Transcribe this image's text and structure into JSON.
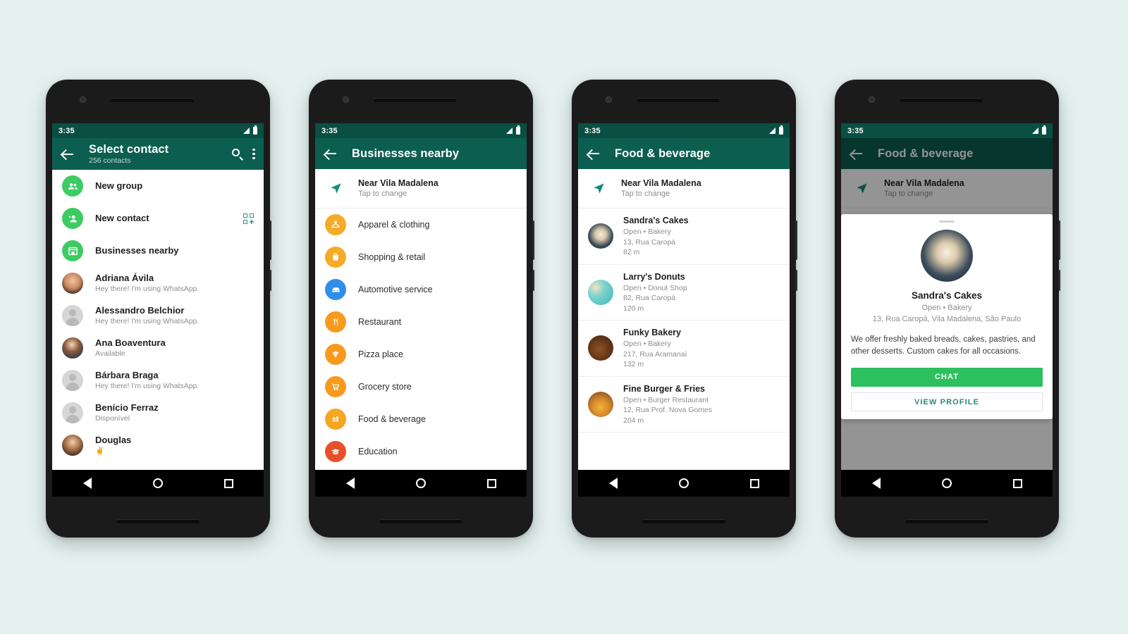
{
  "colors": {
    "page_background": "#e4f1ef",
    "appbar_teal": "#0c5e50",
    "statusbar_teal": "#0a4f43",
    "accent_green": "#3dcb64",
    "chat_button_green": "#2cc15e",
    "link_teal": "#2a8a78"
  },
  "phones": [
    {
      "status": {
        "time": "3:35",
        "signal_icon": "signal-triangle-icon",
        "battery_icon": "battery-icon"
      },
      "appbar": {
        "back_icon": "back-arrow-icon",
        "title": "Select contact",
        "subtitle": "256 contacts",
        "search_icon": "search-icon",
        "more_icon": "overflow-menu-icon"
      },
      "actions": [
        {
          "label": "New group",
          "icon": "new-group-icon",
          "icon_color": "#3dcb64"
        },
        {
          "label": "New contact",
          "icon": "new-contact-icon",
          "icon_color": "#3dcb64",
          "trailing_icon": "qr-code-icon"
        },
        {
          "label": "Businesses nearby",
          "icon": "storefront-icon",
          "icon_color": "#3dcb64"
        }
      ],
      "contacts": [
        {
          "name": "Adriana Ávila",
          "status": "Hey there! I'm using WhatsApp.",
          "avatar": "photo"
        },
        {
          "name": "Alessandro Belchior",
          "status": "Hey there! I'm using WhatsApp.",
          "avatar": "placeholder"
        },
        {
          "name": "Ana Boaventura",
          "status": "Available",
          "avatar": "photo"
        },
        {
          "name": "Bárbara Braga",
          "status": "Hey there! I'm using WhatsApp.",
          "avatar": "placeholder"
        },
        {
          "name": "Benício Ferraz",
          "status": "Disponível",
          "avatar": "placeholder"
        },
        {
          "name": "Douglas",
          "status": "✌️",
          "avatar": "photo"
        }
      ]
    },
    {
      "status": {
        "time": "3:35",
        "signal_icon": "signal-triangle-icon",
        "battery_icon": "battery-icon"
      },
      "appbar": {
        "back_icon": "back-arrow-icon",
        "title": "Businesses nearby"
      },
      "location": {
        "icon": "navigation-arrow-icon",
        "title": "Near Vila Madalena",
        "subtitle": "Tap to change"
      },
      "categories": [
        {
          "label": "Apparel & clothing",
          "icon": "hanger-icon",
          "color": "#f5ab28"
        },
        {
          "label": "Shopping & retail",
          "icon": "shopping-bag-icon",
          "color": "#f5ab28"
        },
        {
          "label": "Automotive service",
          "icon": "car-icon",
          "color": "#2f8eea"
        },
        {
          "label": "Restaurant",
          "icon": "cutlery-icon",
          "color": "#f79a1e"
        },
        {
          "label": "Pizza place",
          "icon": "pizza-slice-icon",
          "color": "#f79a1e"
        },
        {
          "label": "Grocery store",
          "icon": "shopping-cart-icon",
          "color": "#f79a1e"
        },
        {
          "label": "Food & beverage",
          "icon": "burger-drink-icon",
          "color": "#f5a623"
        },
        {
          "label": "Education",
          "icon": "graduation-cap-icon",
          "color": "#e8502a"
        }
      ]
    },
    {
      "status": {
        "time": "3:35",
        "signal_icon": "signal-triangle-icon",
        "battery_icon": "battery-icon"
      },
      "appbar": {
        "back_icon": "back-arrow-icon",
        "title": "Food & beverage"
      },
      "location": {
        "icon": "navigation-arrow-icon",
        "title": "Near Vila Madalena",
        "subtitle": "Tap to change"
      },
      "businesses": [
        {
          "name": "Sandra's Cakes",
          "meta": "Open • Bakery",
          "address": "13, Rua Caropá",
          "distance": "82 m",
          "thumb": "cake-photo"
        },
        {
          "name": "Larry's Donuts",
          "meta": "Open • Donut Shop",
          "address": "82, Rua Caropá",
          "distance": "120 m",
          "thumb": "donut-photo"
        },
        {
          "name": "Funky Bakery",
          "meta": "Open • Bakery",
          "address": "217, Rua Aramanaí",
          "distance": "132 m",
          "thumb": "bread-photo"
        },
        {
          "name": "Fine Burger & Fries",
          "meta": "Open • Burger Restaurant",
          "address": "12, Rua Prof. Nova Gomes",
          "distance": "204 m",
          "thumb": "burger-photo"
        }
      ]
    },
    {
      "status": {
        "time": "3:35",
        "signal_icon": "signal-triangle-icon",
        "battery_icon": "battery-icon"
      },
      "appbar": {
        "back_icon": "back-arrow-icon",
        "title": "Food & beverage"
      },
      "location": {
        "icon": "navigation-arrow-icon",
        "title": "Near Vila Madalena",
        "subtitle": "Tap to change"
      },
      "sheet": {
        "photo": "cake-photo",
        "name": "Sandra's Cakes",
        "meta": "Open • Bakery",
        "address": "13, Rua Caropá, Vila Madalena, São Paulo",
        "description": "We offer freshly baked breads, cakes, pastries, and other desserts. Custom cakes for all occasions.",
        "chat_label": "CHAT",
        "profile_label": "VIEW PROFILE"
      }
    }
  ],
  "navbar": {
    "back_icon": "nav-back-triangle-icon",
    "home_icon": "nav-home-circle-icon",
    "recent_icon": "nav-recent-square-icon"
  }
}
